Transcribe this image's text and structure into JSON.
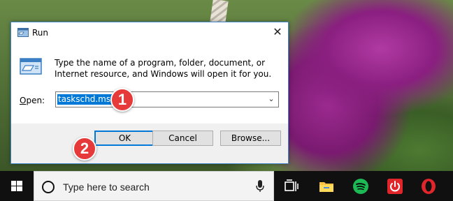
{
  "dialog": {
    "title": "Run",
    "description": "Type the name of a program, folder, document, or Internet resource, and Windows will open it for you.",
    "open_label_first": "O",
    "open_label_rest": "pen:",
    "open_value": "taskschd.msc",
    "ok_label": "OK",
    "cancel_label": "Cancel",
    "browse_label": "Browse...",
    "close_glyph": "✕"
  },
  "annotations": {
    "step1": "1",
    "step2": "2",
    "color": "#e53a39"
  },
  "taskbar": {
    "search_placeholder": "Type here to search",
    "pinned": [
      "task-view-icon",
      "file-explorer-icon",
      "spotify-icon",
      "power-app-icon",
      "opera-icon"
    ]
  },
  "colors": {
    "accent": "#0078d7",
    "taskbar": "#101010",
    "spotify": "#1db954",
    "opera": "#e0262b"
  }
}
